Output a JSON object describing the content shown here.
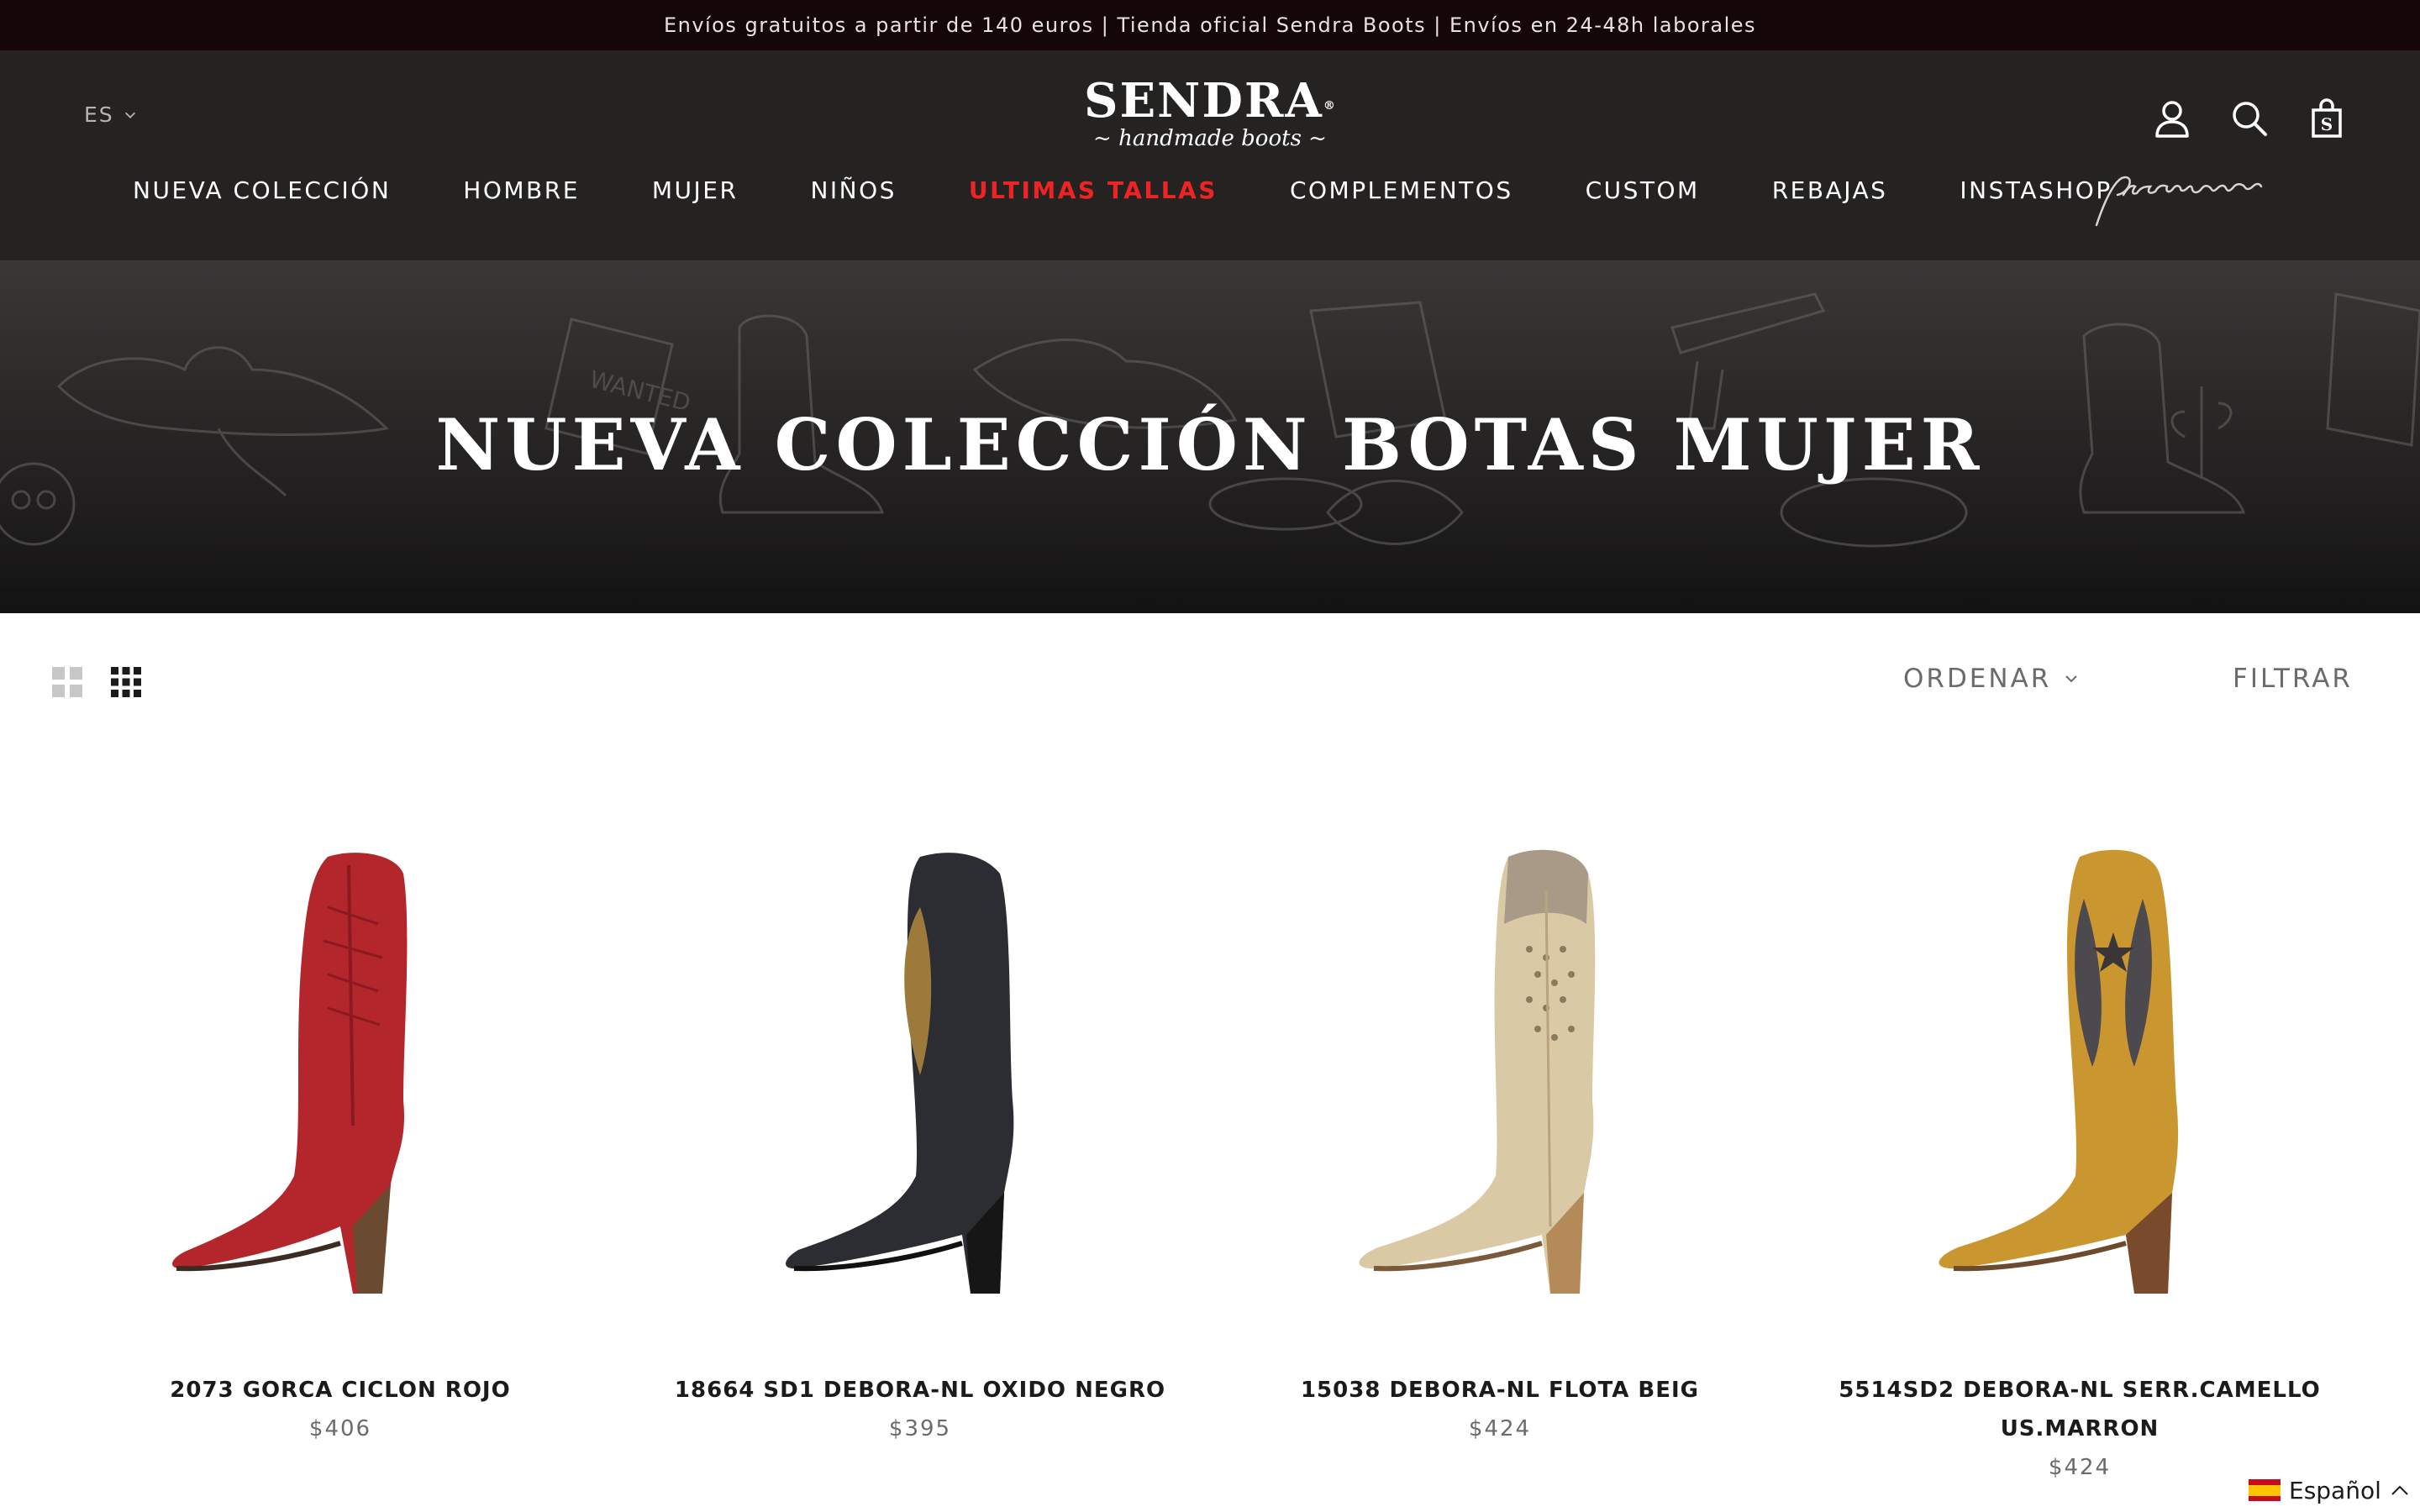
{
  "announcement": "Envíos gratuitos a partir de 140 euros | Tienda oficial Sendra Boots | Envíos en 24-48h laborales",
  "header": {
    "language": "ES",
    "logo_main": "SENDRA",
    "logo_registered": "®",
    "logo_sub": "~ handmade boots ~",
    "icons": [
      "account-icon",
      "search-icon",
      "cart-icon"
    ],
    "premium_label": "premium"
  },
  "nav": {
    "items": [
      {
        "label": "NUEVA COLECCIÓN"
      },
      {
        "label": "HOMBRE"
      },
      {
        "label": "MUJER"
      },
      {
        "label": "NIÑOS"
      },
      {
        "label": "ULTIMAS TALLAS",
        "highlight": true
      },
      {
        "label": "COMPLEMENTOS"
      },
      {
        "label": "CUSTOM"
      },
      {
        "label": "REBAJAS"
      },
      {
        "label": "INSTASHOP"
      }
    ],
    "highlight_color": "#ee2424"
  },
  "hero": {
    "title": "NUEVA COLECCIÓN BOTAS MUJER"
  },
  "toolbar": {
    "sort_label": "ORDENAR",
    "filter_label": "FILTRAR",
    "view_icons": [
      "grid-2-icon",
      "grid-3-icon"
    ]
  },
  "products": [
    {
      "name": "2073 GORCA CICLON ROJO",
      "price": "$406",
      "color": "#b3262c"
    },
    {
      "name": "18664 SD1 DEBORA-NL OXIDO NEGRO",
      "price": "$395",
      "color": "#2c2d33"
    },
    {
      "name": "15038 DEBORA-NL FLOTA BEIG",
      "price": "$424",
      "color": "#d9c9a5"
    },
    {
      "name": "5514SD2 DEBORA-NL SERR.CAMELLO US.MARRON",
      "price": "$424",
      "color": "#c9962f"
    }
  ],
  "language_widget": {
    "label": "Español"
  },
  "colors": {
    "announcement_bg": "#150707",
    "header_bg": "#252222",
    "text_dark": "#1c1b1b",
    "text_muted": "#6d6a6a"
  }
}
